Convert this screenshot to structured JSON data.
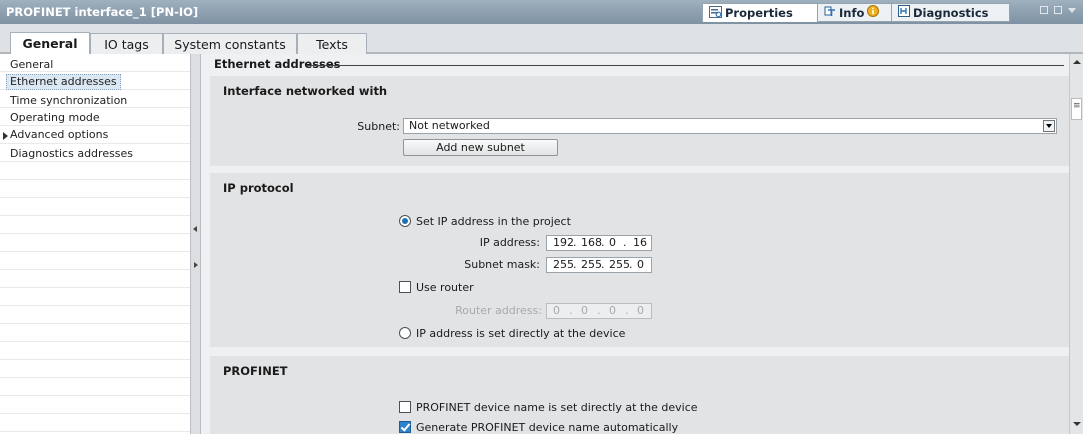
{
  "window": {
    "title": "PROFINET interface_1 [PN-IO]"
  },
  "panel_tabs": [
    {
      "label": "Properties",
      "icon": "properties-icon",
      "active": true
    },
    {
      "label": "Info",
      "icon": "info-icon"
    },
    {
      "label": "Diagnostics",
      "icon": "diagnostics-icon"
    }
  ],
  "tabs": [
    "General",
    "IO tags",
    "System constants",
    "Texts"
  ],
  "nav": [
    "General",
    "Ethernet addresses",
    "Time synchronization",
    "Operating mode",
    "Advanced options",
    "Diagnostics addresses"
  ],
  "section": {
    "title": "Ethernet addresses"
  },
  "networked": {
    "title": "Interface networked with",
    "subnet_label": "Subnet:",
    "subnet_value": "Not networked",
    "add_subnet": "Add new subnet"
  },
  "ip": {
    "title": "IP protocol",
    "set_in_project": "Set IP address in the project",
    "ip_label": "IP address:",
    "ip_octets": [
      "192",
      "168",
      "0",
      "16"
    ],
    "mask_label": "Subnet mask:",
    "mask_octets": [
      "255",
      "255",
      "255",
      "0"
    ],
    "use_router": "Use router",
    "router_label": "Router address:",
    "router_octets": [
      "0",
      "0",
      "0",
      "0"
    ],
    "set_at_device": "IP address is set directly at the device"
  },
  "profinet": {
    "title": "PROFINET",
    "name_at_device": "PROFINET device name is set directly at the device",
    "generate_name": "Generate PROFINET device name automatically"
  },
  "colors": {
    "title_bar": "#8a9cac",
    "accent": "#2e82c9"
  }
}
